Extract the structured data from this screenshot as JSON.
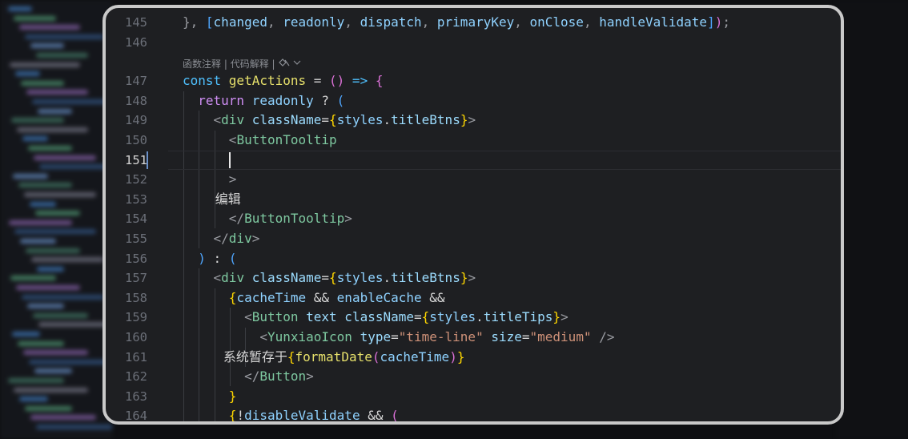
{
  "editor": {
    "language": "javascript-react",
    "active_line": 151,
    "codelens": {
      "items": [
        "函数注释",
        "代码解释"
      ],
      "separator": " | ",
      "icon": "ai-assist-icon"
    },
    "lines": [
      {
        "n": "145",
        "tokens": [
          [
            "punc",
            "}, "
          ],
          [
            "br3",
            "["
          ],
          [
            "var",
            "changed"
          ],
          [
            "punc",
            ", "
          ],
          [
            "var",
            "readonly"
          ],
          [
            "punc",
            ", "
          ],
          [
            "var",
            "dispatch"
          ],
          [
            "punc",
            ", "
          ],
          [
            "var",
            "primaryKey"
          ],
          [
            "punc",
            ", "
          ],
          [
            "var",
            "onClose"
          ],
          [
            "punc",
            ", "
          ],
          [
            "var",
            "handleValidate"
          ],
          [
            "br3",
            "]"
          ],
          [
            "br2",
            ")"
          ],
          [
            "punc",
            ";"
          ]
        ]
      },
      {
        "n": "146",
        "tokens": []
      },
      {
        "n": "147",
        "tokens": [
          [
            "kw2",
            "const "
          ],
          [
            "fnc",
            "getActions"
          ],
          [
            "plain",
            " = "
          ],
          [
            "br2",
            "()"
          ],
          [
            "kw2",
            " => "
          ],
          [
            "br2",
            "{"
          ]
        ]
      },
      {
        "n": "148",
        "tokens": [
          [
            "kw",
            "  return "
          ],
          [
            "var",
            "readonly"
          ],
          [
            "plain",
            " ? "
          ],
          [
            "br3",
            "("
          ]
        ]
      },
      {
        "n": "149",
        "tokens": [
          [
            "punc",
            "    <"
          ],
          [
            "tag",
            "div "
          ],
          [
            "attr",
            "className"
          ],
          [
            "plain",
            "="
          ],
          [
            "br1",
            "{"
          ],
          [
            "var",
            "styles"
          ],
          [
            "plain",
            "."
          ],
          [
            "prop",
            "titleBtns"
          ],
          [
            "br1",
            "}"
          ],
          [
            "punc",
            ">"
          ]
        ]
      },
      {
        "n": "150",
        "tokens": [
          [
            "punc",
            "      <"
          ],
          [
            "tag",
            "ButtonTooltip"
          ]
        ]
      },
      {
        "n": "151",
        "tokens": []
      },
      {
        "n": "152",
        "tokens": [
          [
            "punc",
            "      >"
          ]
        ]
      },
      {
        "n": "153",
        "tokens": [
          [
            "zh",
            "        编辑"
          ]
        ]
      },
      {
        "n": "154",
        "tokens": [
          [
            "punc",
            "      </"
          ],
          [
            "tag",
            "ButtonTooltip"
          ],
          [
            "punc",
            ">"
          ]
        ]
      },
      {
        "n": "155",
        "tokens": [
          [
            "punc",
            "    </"
          ],
          [
            "tag",
            "div"
          ],
          [
            "punc",
            ">"
          ]
        ]
      },
      {
        "n": "156",
        "tokens": [
          [
            "br3",
            "  )"
          ],
          [
            "plain",
            " : "
          ],
          [
            "br3",
            "("
          ]
        ]
      },
      {
        "n": "157",
        "tokens": [
          [
            "punc",
            "    <"
          ],
          [
            "tag",
            "div "
          ],
          [
            "attr",
            "className"
          ],
          [
            "plain",
            "="
          ],
          [
            "br1",
            "{"
          ],
          [
            "var",
            "styles"
          ],
          [
            "plain",
            "."
          ],
          [
            "prop",
            "titleBtns"
          ],
          [
            "br1",
            "}"
          ],
          [
            "punc",
            ">"
          ]
        ]
      },
      {
        "n": "158",
        "tokens": [
          [
            "br1",
            "      {"
          ],
          [
            "var",
            "cacheTime"
          ],
          [
            "plain",
            " && "
          ],
          [
            "var",
            "enableCache"
          ],
          [
            "plain",
            " &&"
          ]
        ]
      },
      {
        "n": "159",
        "tokens": [
          [
            "punc",
            "        <"
          ],
          [
            "tag",
            "Button "
          ],
          [
            "attr",
            "text className"
          ],
          [
            "plain",
            "="
          ],
          [
            "br1",
            "{"
          ],
          [
            "var",
            "styles"
          ],
          [
            "plain",
            "."
          ],
          [
            "prop",
            "titleTips"
          ],
          [
            "br1",
            "}"
          ],
          [
            "punc",
            ">"
          ]
        ]
      },
      {
        "n": "160",
        "tokens": [
          [
            "punc",
            "          <"
          ],
          [
            "tag",
            "YunxiaoIcon "
          ],
          [
            "attr",
            "type"
          ],
          [
            "plain",
            "="
          ],
          [
            "str",
            "\"time-line\""
          ],
          [
            "attr",
            " size"
          ],
          [
            "plain",
            "="
          ],
          [
            "str",
            "\"medium\""
          ],
          [
            "punc",
            " />"
          ]
        ]
      },
      {
        "n": "161",
        "tokens": [
          [
            "zh",
            "          系统暂存于"
          ],
          [
            "br1",
            "{"
          ],
          [
            "fnc",
            "formatDate"
          ],
          [
            "br2",
            "("
          ],
          [
            "var",
            "cacheTime"
          ],
          [
            "br2",
            ")"
          ],
          [
            "br1",
            "}"
          ]
        ]
      },
      {
        "n": "162",
        "tokens": [
          [
            "punc",
            "        </"
          ],
          [
            "tag",
            "Button"
          ],
          [
            "punc",
            ">"
          ]
        ]
      },
      {
        "n": "163",
        "tokens": [
          [
            "br1",
            "      }"
          ]
        ]
      },
      {
        "n": "164",
        "tokens": [
          [
            "br1",
            "      {"
          ],
          [
            "plain",
            "!"
          ],
          [
            "var",
            "disableValidate"
          ],
          [
            "plain",
            " && "
          ],
          [
            "br2",
            "("
          ]
        ]
      }
    ]
  },
  "colors": {
    "panel_bg": "#1e1f22",
    "panel_border": "#c9c9c9",
    "keyword": "#cf8ef4",
    "variable": "#8fd2ff",
    "tag": "#7ec8a0",
    "string": "#ce9178",
    "function": "#e6e06b"
  }
}
